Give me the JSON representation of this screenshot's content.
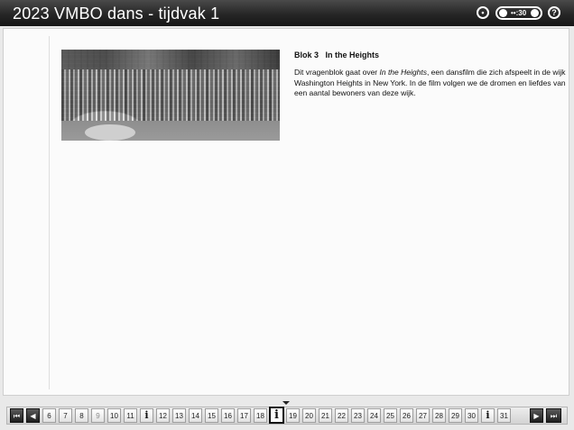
{
  "header": {
    "title": "2023 VMBO dans - tijdvak 1",
    "timer_text": "••:30",
    "audio_icon": "speaker-icon",
    "help_label": "?"
  },
  "article": {
    "image_alt": "In the Heights dance scene",
    "heading": "Blok 3   In the Heights",
    "paragraph_before": "Dit vragenblok gaat over ",
    "paragraph_italic": "In the Heights",
    "paragraph_after": ", een dansfilm die zich afspeelt in de wijk Washington Heights in New York. In de film volgen we de dromen en liefdes van een aantal bewoners van deze wijk."
  },
  "navigation": {
    "first_label": "⏮",
    "prev_label": "◀",
    "next_label": "▶",
    "last_label": "⏭",
    "items": [
      "6",
      "7",
      "8",
      "9",
      "10",
      "11",
      "i",
      "12",
      "13",
      "14",
      "15",
      "16",
      "17",
      "18",
      "i",
      "19",
      "20",
      "21",
      "22",
      "23",
      "24",
      "25",
      "26",
      "27",
      "28",
      "29",
      "30",
      "i",
      "31"
    ]
  }
}
